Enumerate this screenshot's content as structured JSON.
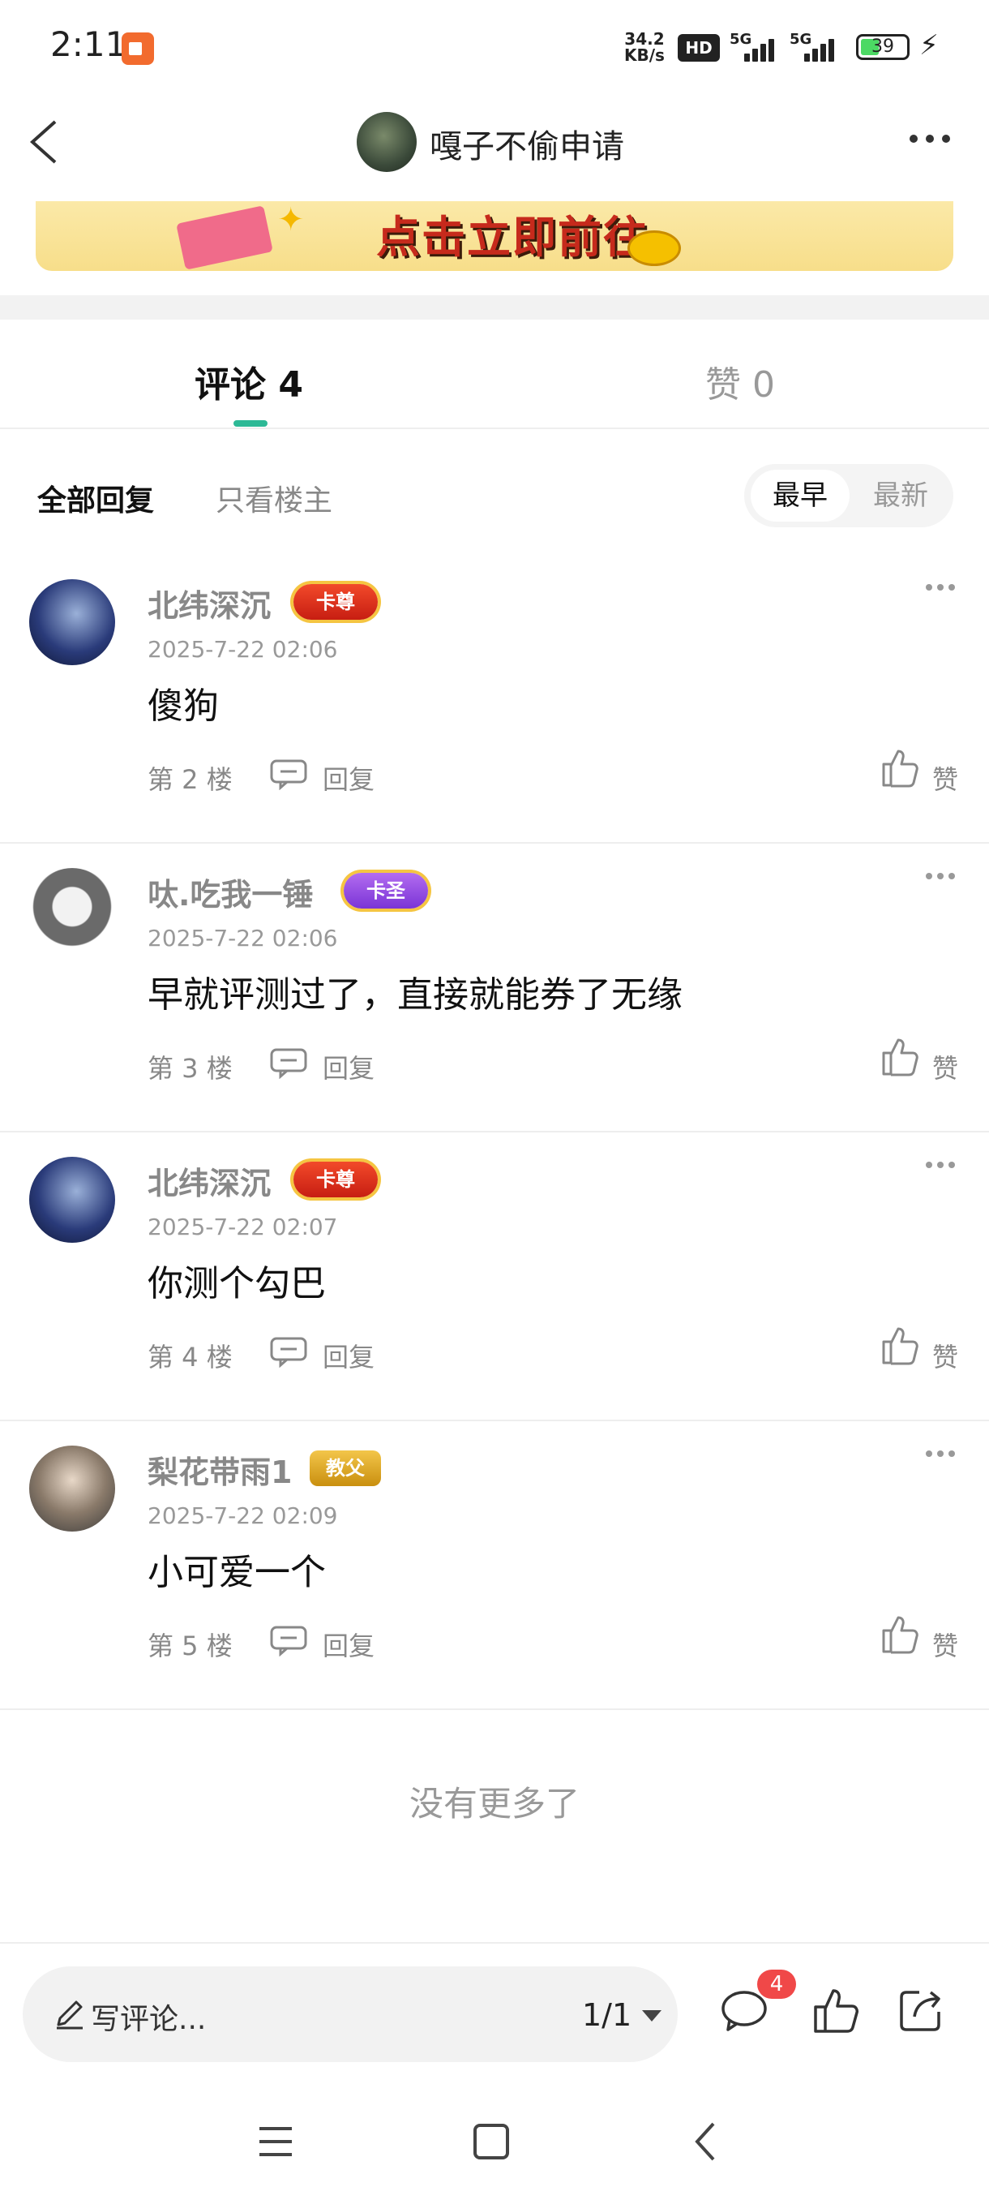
{
  "status_bar": {
    "time": "2:11",
    "speed_value": "34.2",
    "speed_unit": "KB/s",
    "hd_label": "HD",
    "net1": "5G",
    "net2": "5G",
    "battery": "39"
  },
  "header": {
    "title": "嘎子不偷申请"
  },
  "banner": {
    "text": "点击立即前往"
  },
  "tabs": [
    {
      "label": "评论 4",
      "active": true
    },
    {
      "label": "赞 0",
      "active": false
    }
  ],
  "filters": {
    "all": "全部回复",
    "op_only": "只看楼主",
    "sort_earliest": "最早",
    "sort_newest": "最新"
  },
  "comments": [
    {
      "name": "北纬深沉",
      "badge": "卡尊",
      "time": "2025-7-22 02:06",
      "text": "傻狗",
      "floor": "第 2 楼",
      "reply": "回复",
      "like": "赞"
    },
    {
      "name": "呔.吃我一锤",
      "badge": "卡圣",
      "time": "2025-7-22 02:06",
      "text": "早就评测过了，直接就能券了无缘",
      "floor": "第 3 楼",
      "reply": "回复",
      "like": "赞"
    },
    {
      "name": "北纬深沉",
      "badge": "卡尊",
      "time": "2025-7-22 02:07",
      "text": "你测个勾巴",
      "floor": "第 4 楼",
      "reply": "回复",
      "like": "赞"
    },
    {
      "name": "梨花带雨1",
      "badge": "教父",
      "time": "2025-7-22 02:09",
      "text": "小可爱一个",
      "floor": "第 5 楼",
      "reply": "回复",
      "like": "赞"
    }
  ],
  "end_text": "没有更多了",
  "bottom_bar": {
    "placeholder": "写评论...",
    "page": "1/1",
    "comment_count": "4"
  },
  "colors": {
    "accent": "#2db996",
    "badge_red": "#f04848",
    "banner_text": "#c62a1c"
  },
  "icons": [
    "back-icon",
    "more-icon",
    "pencil-icon",
    "comment-icon",
    "thumb-up-icon",
    "share-icon",
    "menu-icon",
    "home-icon",
    "nav-back-icon",
    "reply-icon"
  ]
}
